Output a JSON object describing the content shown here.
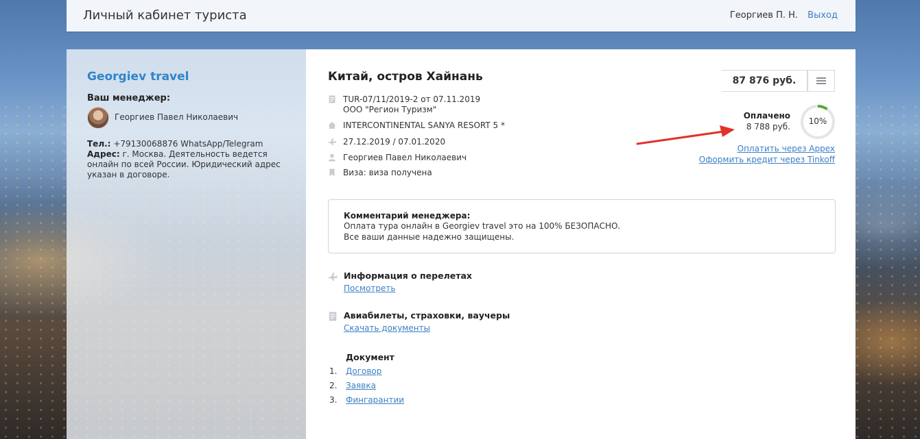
{
  "header": {
    "title": "Личный кабинет туриста",
    "user": "Георгиев П. Н.",
    "logout": "Выход"
  },
  "sidebar": {
    "agency": "Georgiev travel",
    "manager_label": "Ваш менеджер:",
    "manager_name": "Георгиев Павел Николаевич",
    "phone_label": "Тел.:",
    "phone": "+79130068876 WhatsApp/Telegram",
    "address_label": "Адрес:",
    "address": "г. Москва. Деятельность ведется онлайн по всей России. Юридический адрес указан в договоре."
  },
  "tour": {
    "title": "Китай, остров Хайнань",
    "contract": "TUR-07/11/2019-2 от 07.11.2019",
    "operator": "ООО \"Регион Туризм\"",
    "hotel": "INTERCONTINENTAL SANYA RESORT 5 *",
    "dates": "27.12.2019 / 07.01.2020",
    "tourist": "Георгиев Павел Николаевич",
    "visa": "Виза: виза получена"
  },
  "payment": {
    "price": "87 876 руб.",
    "paid_label": "Оплачено",
    "paid_sum": "8 788 руб.",
    "paid_percent_label": "10%",
    "paid_fraction": 0.1,
    "pay_link": "Оплатить через Appex",
    "credit_link": "Оформить кредит через Tinkoff",
    "ring_color": "#5aa832"
  },
  "comment": {
    "header": "Комментарий менеджера:",
    "line1": "Оплата тура онлайн в Georgiev travel это на 100% БЕЗОПАСНО.",
    "line2": "Все ваши данные надежно защищены."
  },
  "flights": {
    "header": "Информация о перелетах",
    "link": "Посмотреть"
  },
  "tickets": {
    "header": "Авиабилеты, страховки, ваучеры",
    "link": "Скачать документы"
  },
  "documents": {
    "header": "Документ",
    "items": [
      {
        "num": "1.",
        "label": "Договор"
      },
      {
        "num": "2.",
        "label": "Заявка"
      },
      {
        "num": "3.",
        "label": "Фингарантии"
      }
    ]
  },
  "colors": {
    "link": "#3b7fc4",
    "brand": "#2f85c8",
    "annotation_arrow": "#e0322b"
  }
}
